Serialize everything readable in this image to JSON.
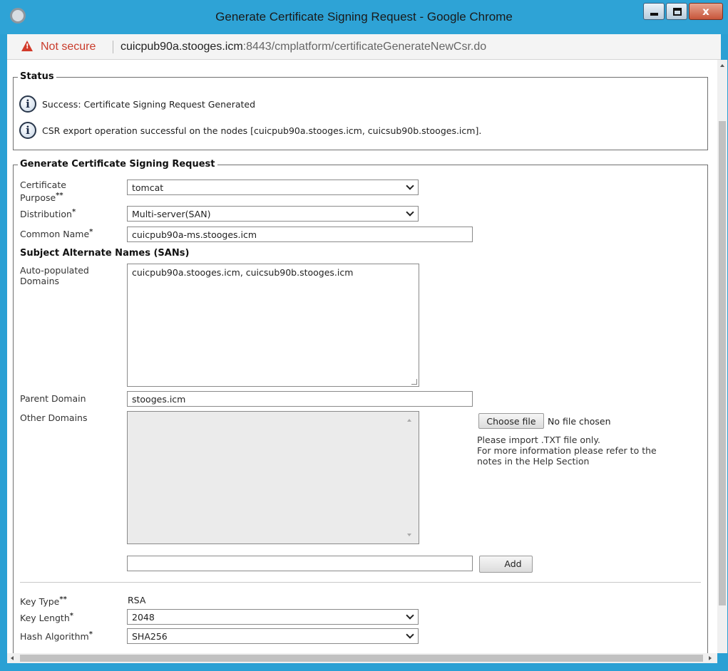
{
  "window": {
    "title": "Generate Certificate Signing Request - Google Chrome",
    "close_label": "x"
  },
  "address": {
    "security_label": "Not secure",
    "host": "cuicpub90a.stooges.icm",
    "path": ":8443/cmplatform/certificateGenerateNewCsr.do"
  },
  "status": {
    "legend": "Status",
    "messages": [
      "Success: Certificate Signing Request Generated",
      "CSR export operation successful on the nodes [cuicpub90a.stooges.icm, cuicsub90b.stooges.icm]."
    ]
  },
  "form": {
    "legend": "Generate Certificate Signing Request",
    "certificate_purpose": {
      "label_line1": "Certificate",
      "label_line2": "Purpose",
      "req": "**",
      "value": "tomcat"
    },
    "distribution": {
      "label": "Distribution",
      "req": "*",
      "value": "Multi-server(SAN)"
    },
    "common_name": {
      "label": "Common Name",
      "req": "*",
      "value": "cuicpub90a-ms.stooges.icm"
    },
    "san_heading": "Subject Alternate Names (SANs)",
    "auto_domains": {
      "label_line1": "Auto-populated",
      "label_line2": "Domains",
      "value": "cuicpub90a.stooges.icm, cuicsub90b.stooges.icm"
    },
    "parent_domain": {
      "label": "Parent Domain",
      "value": "stooges.icm"
    },
    "other_domains": {
      "label": "Other Domains",
      "value": ""
    },
    "file": {
      "choose_label": "Choose file",
      "status": "No file chosen",
      "help_line1": "Please import .TXT file only.",
      "help_line2": "For more information please refer to the",
      "help_line3": "notes in the Help Section"
    },
    "add_input_value": "",
    "add_label": "Add",
    "key_type": {
      "label": "Key Type",
      "req": "**",
      "value": "RSA"
    },
    "key_length": {
      "label": "Key Length",
      "req": "*",
      "value": "2048"
    },
    "hash_algorithm": {
      "label": "Hash Algorithm",
      "req": "*",
      "value": "SHA256"
    }
  }
}
